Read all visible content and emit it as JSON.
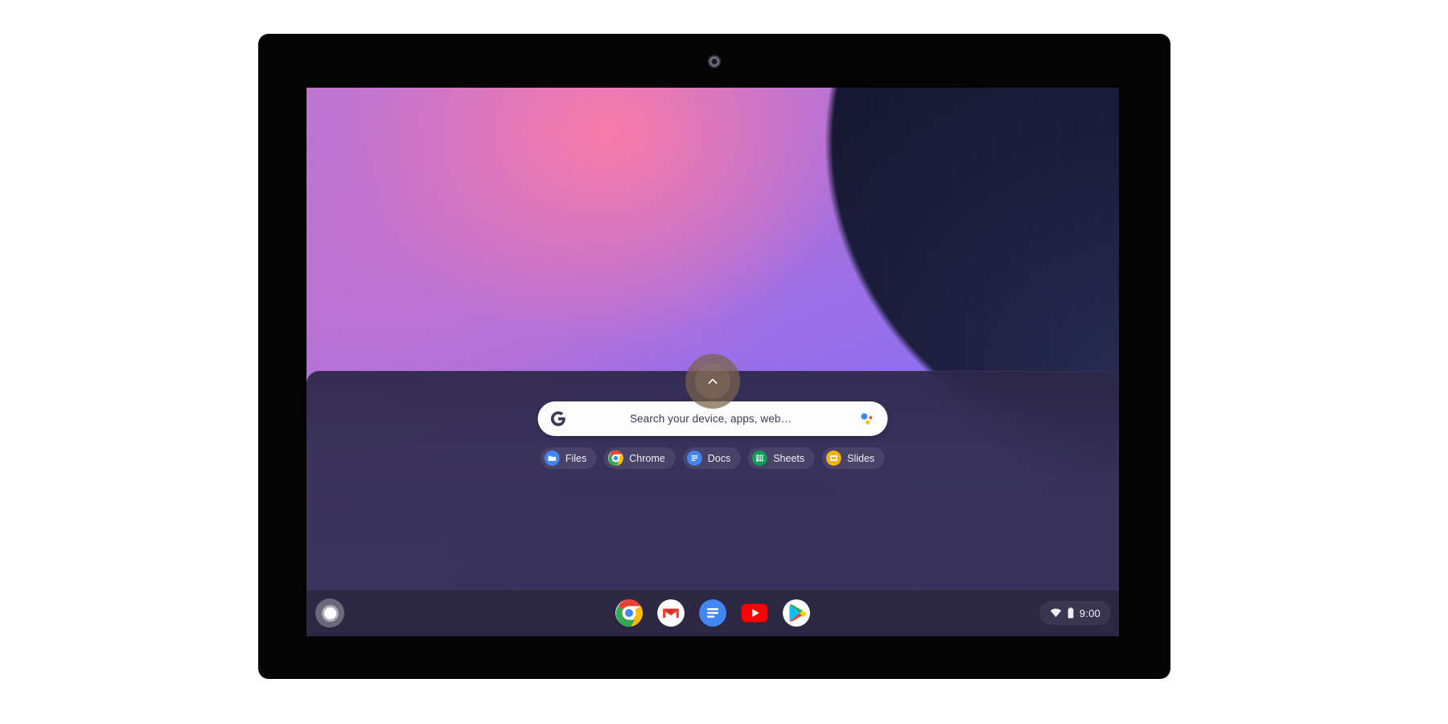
{
  "device": {
    "name": "Chromebook tablet",
    "camera_label": "front-camera"
  },
  "desktop": {
    "wallpaper_name": "purple-gradient-wallpaper",
    "colors": {
      "wallpaper_pink": "#f87ba8",
      "wallpaper_magenta": "#c273cf",
      "wallpaper_purple": "#7b5cff",
      "wallpaper_dark_navy": "#1b1d3c",
      "launcher_panel": "#332d50",
      "shelf": "#29253f",
      "search_bar": "#fdfdfd",
      "search_text": "#3b3a55",
      "chip_text": "#f0eff6"
    }
  },
  "launcher": {
    "expand_button": {
      "name": "expand-launcher-button",
      "icon": "chevron-up-icon"
    },
    "search": {
      "placeholder": "Search your device, apps, web…",
      "value": "",
      "leading_icon": "google-g-icon",
      "trailing_icon": "google-assistant-icon"
    },
    "quick_apps": [
      {
        "label": "Files",
        "icon": "files-icon"
      },
      {
        "label": "Chrome",
        "icon": "chrome-icon"
      },
      {
        "label": "Docs",
        "icon": "google-docs-icon"
      },
      {
        "label": "Sheets",
        "icon": "google-sheets-icon"
      },
      {
        "label": "Slides",
        "icon": "google-slides-icon"
      }
    ]
  },
  "shelf": {
    "launcher_button": {
      "name": "launcher-button",
      "icon": "launcher-circle-icon"
    },
    "apps": [
      {
        "label": "Chrome",
        "icon": "chrome-icon"
      },
      {
        "label": "Gmail",
        "icon": "gmail-icon"
      },
      {
        "label": "Google Docs",
        "icon": "google-docs-icon"
      },
      {
        "label": "YouTube",
        "icon": "youtube-icon"
      },
      {
        "label": "Play Store",
        "icon": "play-store-icon"
      }
    ],
    "status_tray": {
      "wifi_icon": "wifi-icon",
      "battery_icon": "battery-icon",
      "time": "9:00"
    }
  }
}
